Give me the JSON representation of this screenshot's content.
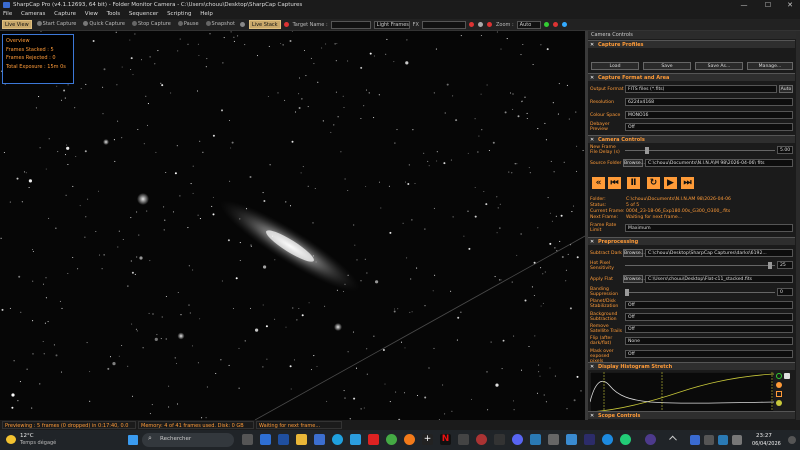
{
  "window": {
    "title": "SharpCap Pro (v4.1.12693, 64 bit) - Folder Monitor Camera - C:\\Users\\chouu\\Desktop\\SharpCap Captures",
    "controls": [
      "—",
      "☐",
      "✕"
    ]
  },
  "menu": [
    "File",
    "Cameras",
    "Capture",
    "View",
    "Tools",
    "Sequencer",
    "Scripting",
    "Help"
  ],
  "toolbar": {
    "live_view": "Live View",
    "start_capture": "Start Capture",
    "quick_capture": "Quick Capture",
    "stop_capture": "Stop Capture",
    "pause": "Pause",
    "snapshot": "Snapshot",
    "live_stack": "Live Stack",
    "target_name_label": "Target Name :",
    "frame_type": "Light Frames",
    "fx_label": "FX",
    "zoom_label": "Zoom :",
    "zoom_value": "Auto"
  },
  "overview": {
    "title": "Overview",
    "rows": [
      "Frames Stacked : 5",
      "Frames Rejected : 0",
      "Total Exposure : 15m 0s"
    ]
  },
  "panel": {
    "title": "Camera Controls",
    "capture_profiles": {
      "title": "Capture Profiles",
      "buttons": [
        "Load",
        "Save",
        "Save As...",
        "Manage..."
      ]
    },
    "capture_format": {
      "title": "Capture Format and Area",
      "output_format_label": "Output Format",
      "output_format": "FITS files (*.fits)",
      "auto_label": "Auto",
      "resolution_label": "Resolution",
      "resolution": "6224x4168",
      "colour_space_label": "Colour Space",
      "colour_space": "MONO16",
      "debayer_label": "Debayer Preview",
      "debayer": "Off"
    },
    "camera_controls": {
      "title": "Camera Controls",
      "new_frame_delay_label": "New Frame File Delay (s)",
      "new_frame_delay": "5.00",
      "source_folder_label": "Source Folder",
      "browse_label": "Browse...",
      "source_folder": "C:\\chouu\\Documents\\N.I.N.A\\M 98\\2026-04-06\\ fits",
      "folder_label": "Folder:",
      "folder": "C:\\chouu\\Documents\\N.I.N.AM 98\\2026-04-06",
      "status_label": "Status:",
      "status": "5 of 5",
      "current_frame_label": "Current Frame:",
      "current_frame": "0004_23-18-06_Exp180.00s_G300_O300_.fits",
      "next_frame_label": "Next Frame:",
      "next_frame": "Waiting for next frame...",
      "frame_rate_label": "Frame Rate Limit",
      "frame_rate": "Maximum"
    },
    "preprocessing": {
      "title": "Preprocessing",
      "subtract_dark_label": "Subtract Dark",
      "subtract_dark": "C:\\chouu\\Desktop\\SharpCap Captures\\darks\\6192...",
      "hot_pixel_label": "Hot Pixel Sensitivity",
      "hot_pixel": "25",
      "apply_flat_label": "Apply Flat",
      "apply_flat": "C:\\Users\\chouu\\Desktop\\Flat-c11_stacked.fits",
      "banding_label": "Banding Suppression",
      "banding": "0",
      "planet_label": "Planet/Disk Stabilization",
      "planet": "Off",
      "background_label": "Background Subtraction",
      "background": "Off",
      "satellite_label": "Remove Satellite Trails",
      "satellite": "Off",
      "flip_label": "Flip (after dark/flat)",
      "flip": "None",
      "mask_label": "Mask over exposed pixels",
      "mask": "Off"
    },
    "histogram": {
      "title": "Display Histogram Stretch"
    },
    "scope": {
      "title": "Scope Controls"
    }
  },
  "status": {
    "left": "Previewing : 5 frames (0 dropped) in 0:17:40, 0.0 fps",
    "memory": "Memory: 4 of 41 frames used. Disk: 0 GB free.",
    "waiting": "Waiting for next frame..."
  },
  "taskbar": {
    "temp": "12°C",
    "weather": "Temps dégagé",
    "search": "Rechercher",
    "time": "23:27",
    "date": "06/04/2026"
  },
  "colors": {
    "accent": "#ff9b38",
    "overview_border": "#3c78d8"
  }
}
